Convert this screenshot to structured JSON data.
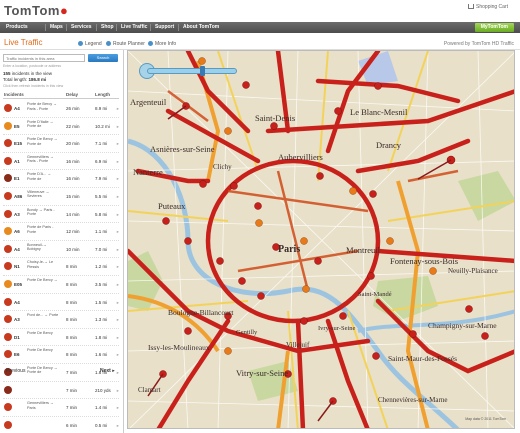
{
  "header": {
    "logo": "TomTom",
    "cart": "Shopping Cart"
  },
  "nav": {
    "items": [
      "Products",
      "Maps",
      "Services",
      "Shop",
      "Live Traffic",
      "Support",
      "About TomTom"
    ],
    "account": "MyTomTom"
  },
  "title_bar": {
    "title": "Live Traffic",
    "tabs": [
      "Legend",
      "Route Planner",
      "More Info"
    ],
    "powered": "Powered by TomTom HD Traffic"
  },
  "panel": {
    "search_placeholder": "Traffic incidents in this area",
    "search_button": "Search",
    "hint": "Enter a location, postcode or address",
    "summary_count": "155",
    "summary_text": " incidents in the view",
    "summary_length_label": "Total length: ",
    "summary_length": "186.8 mi",
    "refresh": "Click then refresh incidents in this view",
    "columns": {
      "incidents": "Incidents",
      "delay": "Delay",
      "length": "Length"
    },
    "previous": "Previous",
    "next": "Next"
  },
  "incidents": [
    {
      "road": "A4",
      "desc": "Porte de Bercy → Paris - Porte",
      "delay": "26 min",
      "length": "8.9 mi",
      "color": "#c83a1e"
    },
    {
      "road": "E5",
      "desc": "Porte D'Italie → Porte de",
      "delay": "22 min",
      "length": "10.2 mi",
      "color": "#e88a1e"
    },
    {
      "road": "E15",
      "desc": "Porte De Bercy → Porte de",
      "delay": "20 min",
      "length": "7.1 mi",
      "color": "#c83a1e"
    },
    {
      "road": "A1",
      "desc": "Gennevilliers → Paris - Porte",
      "delay": "16 min",
      "length": "6.9 mi",
      "color": "#c83a1e"
    },
    {
      "road": "E1",
      "desc": "Porte D'A... → Porte de",
      "delay": "16 min",
      "length": "7.9 mi",
      "color": "#8a2a1a"
    },
    {
      "road": "A86",
      "desc": "Villeneuve → Sevieres",
      "delay": "15 min",
      "length": "5.5 mi",
      "color": "#c83a1e"
    },
    {
      "road": "A3",
      "desc": "Bondy → Paris - Porte",
      "delay": "14 min",
      "length": "5.8 mi",
      "color": "#c83a1e"
    },
    {
      "road": "A6",
      "desc": "Porte de Paris - Porte",
      "delay": "12 min",
      "length": "1.1 mi",
      "color": "#e88a1e"
    },
    {
      "road": "A4",
      "desc": "Bonneuil-→ Bobigny",
      "delay": "10 min",
      "length": "7.0 mi",
      "color": "#c83a1e"
    },
    {
      "road": "N1",
      "desc": "Choisy-le-→ Le Plessis",
      "delay": "8 min",
      "length": "1.2 mi",
      "color": "#c83a1e"
    },
    {
      "road": "E05",
      "desc": "Porte De Bercy →",
      "delay": "8 min",
      "length": "3.5 mi",
      "color": "#e88a1e"
    },
    {
      "road": "A4",
      "desc": "",
      "delay": "8 min",
      "length": "1.5 mi",
      "color": "#c83a1e"
    },
    {
      "road": "A3",
      "desc": "Pont de... → Porte",
      "delay": "8 min",
      "length": "1.3 mi",
      "color": "#c83a1e"
    },
    {
      "road": "D1",
      "desc": "Porte De Bercy",
      "delay": "8 min",
      "length": "1.8 mi",
      "color": "#c83a1e"
    },
    {
      "road": "E6",
      "desc": "Porte De Bercy",
      "delay": "8 min",
      "length": "1.6 mi",
      "color": "#c83a1e"
    },
    {
      "road": "",
      "desc": "Porte De Bercy → Porte de",
      "delay": "7 min",
      "length": "1.8 mi",
      "color": "#8a2a1a"
    },
    {
      "road": "",
      "desc": "",
      "delay": "7 min",
      "length": "210 yds",
      "color": "#8a2a1a"
    },
    {
      "road": "",
      "desc": "Gennevilliers → Paris",
      "delay": "7 min",
      "length": "1.4 mi",
      "color": "#c83a1e"
    },
    {
      "road": "",
      "desc": "",
      "delay": "6 min",
      "length": "0.5 mi",
      "color": "#c83a1e"
    }
  ],
  "map": {
    "labels": [
      "Argenteuil",
      "Saint-Denis",
      "Le Blanc-Mesnil",
      "Drancy",
      "Nanterre",
      "Aubervilliers",
      "Asnières-sur-Seine",
      "Puteaux",
      "Paris",
      "Montreuil",
      "Fontenay-sous-Bois",
      "Neuilly-Plaisance",
      "Boulogne-Billancourt",
      "Champigny-sur-Marne",
      "Issy-les-Moulineaux",
      "Vitry-sur-Seine",
      "Saint-Maur-des-Fossés",
      "Villejuif",
      "Clamart",
      "Gentilly",
      "Ivry-sur-Seine",
      "Chennevières-sur-Marne",
      "Saint-Mandé",
      "Clichy"
    ],
    "copyright": "Map data © 2011 TomTom"
  }
}
